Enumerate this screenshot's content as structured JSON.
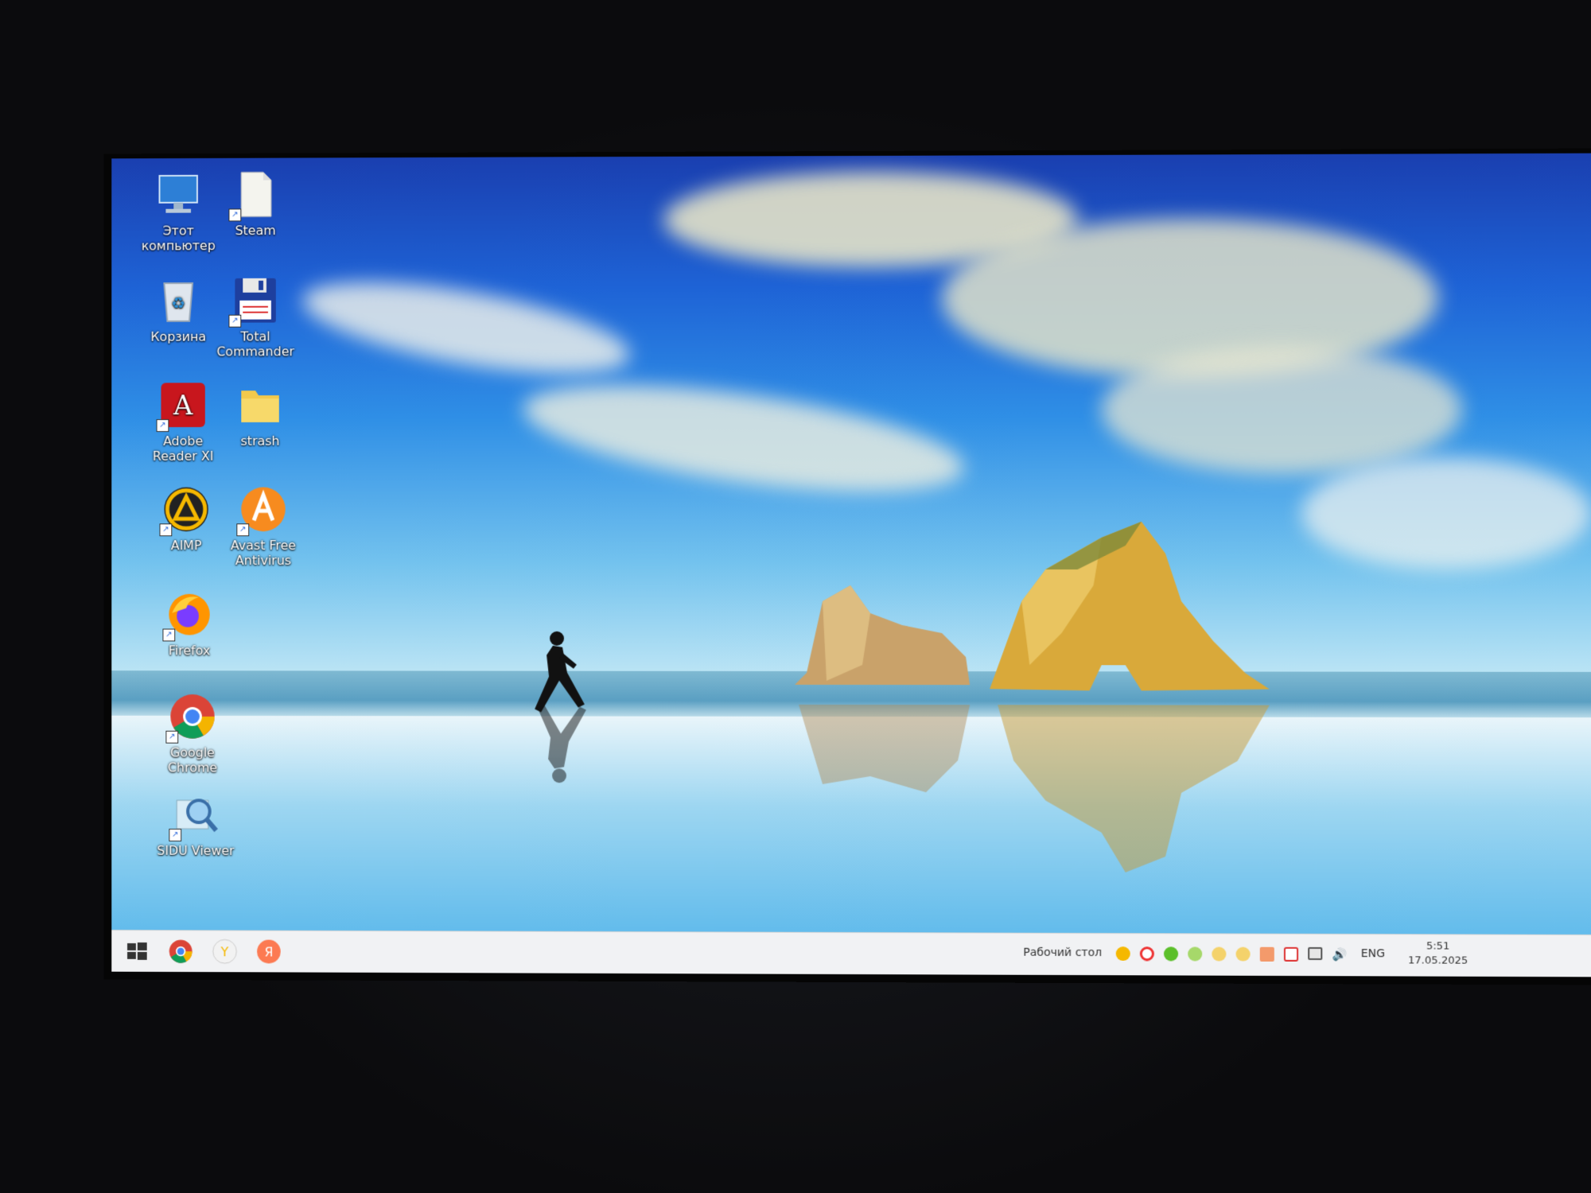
{
  "desktop": {
    "icons": [
      {
        "label": "Этот компьютер",
        "icon": "this-pc-icon"
      },
      {
        "label": "Steam",
        "icon": "steam-file-icon"
      },
      {
        "label": "Корзина",
        "icon": "recycle-bin-icon"
      },
      {
        "label": "Total Commander",
        "icon": "floppy-disk-icon"
      },
      {
        "label": "Adobe Reader XI",
        "icon": "adobe-reader-icon"
      },
      {
        "label": "strash",
        "icon": "folder-icon"
      },
      {
        "label": "AIMP",
        "icon": "aimp-icon"
      },
      {
        "label": "Avast Free Antivirus",
        "icon": "avast-icon"
      },
      {
        "label": "Firefox",
        "icon": "firefox-icon"
      },
      {
        "label": "Google Chrome",
        "icon": "chrome-icon"
      },
      {
        "label": "SIDU Viewer",
        "icon": "magnifier-icon"
      }
    ]
  },
  "taskbar": {
    "pinned": [
      "windows-start-icon",
      "chrome-icon",
      "yandex-browser-icon",
      "yandex-icon"
    ],
    "desktop_label": "Рабочий стол",
    "language": "ENG",
    "time": "5:51",
    "date": "17.05.2025"
  },
  "colors": {
    "taskbar_bg": "#f1f2f4",
    "sky_top": "#1a3fb0",
    "rock": "#d9a93a"
  }
}
